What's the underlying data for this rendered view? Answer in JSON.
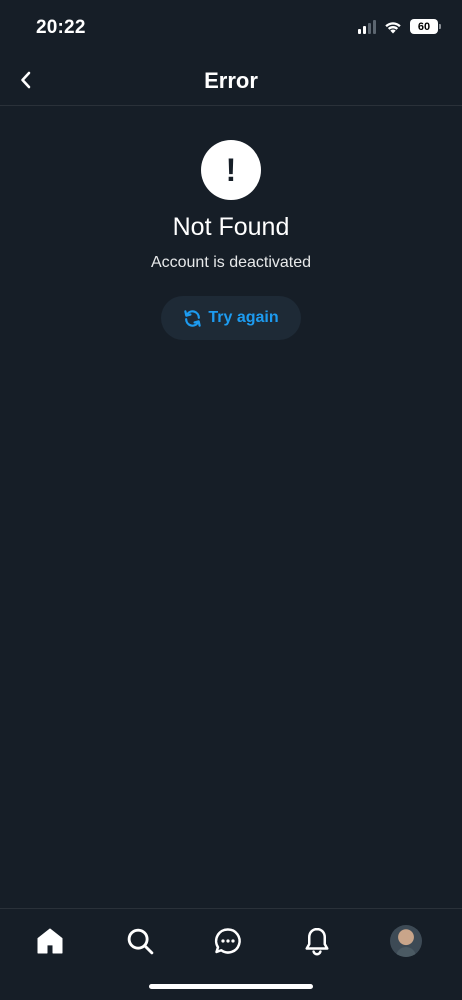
{
  "status_bar": {
    "time": "20:22",
    "battery": "60",
    "icons": [
      "cellular-signal-icon",
      "wifi-icon",
      "battery-icon"
    ]
  },
  "header": {
    "title": "Error",
    "back_icon": "chevron-left-icon"
  },
  "error": {
    "icon": "exclamation-icon",
    "symbol": "!",
    "title": "Not Found",
    "message": "Account is deactivated",
    "retry_label": "Try again",
    "retry_icon": "refresh-icon"
  },
  "bottom_nav": {
    "items": [
      {
        "name": "home",
        "icon": "home-icon",
        "active": true
      },
      {
        "name": "search",
        "icon": "search-icon",
        "active": false
      },
      {
        "name": "messages",
        "icon": "chat-bubble-icon",
        "active": false
      },
      {
        "name": "notifications",
        "icon": "bell-icon",
        "active": false
      },
      {
        "name": "profile",
        "icon": "avatar",
        "active": false
      }
    ]
  },
  "colors": {
    "background": "#161e27",
    "accent": "#1d9bf0",
    "text": "#ffffff",
    "button_bg": "#1e2a36"
  }
}
